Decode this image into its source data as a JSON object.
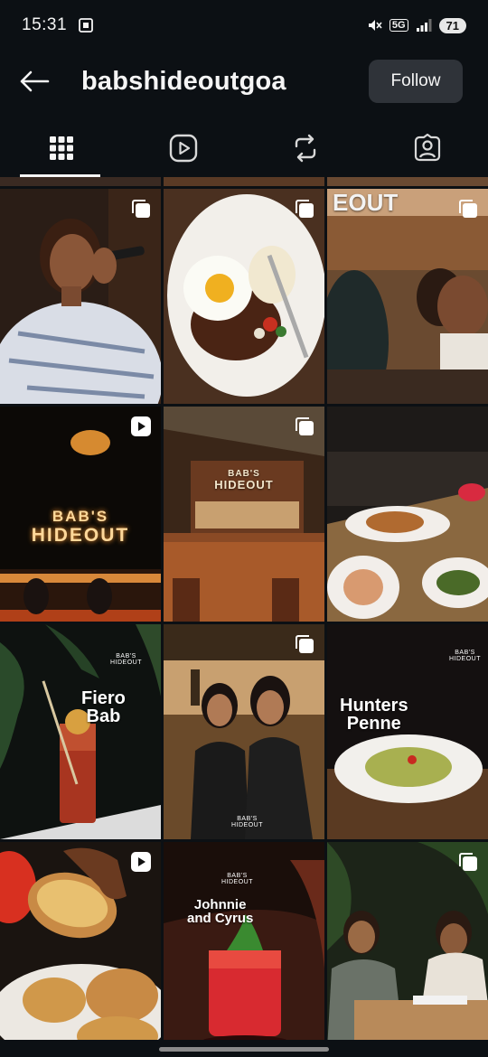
{
  "status": {
    "time": "15:31",
    "network": "5G",
    "battery": "71",
    "icons": [
      "screenshot-icon",
      "mute-icon",
      "signal-icon"
    ]
  },
  "header": {
    "back_icon": "arrow-left-icon",
    "username": "babshideoutgoa",
    "follow_label": "Follow"
  },
  "tabs": [
    {
      "name": "posts",
      "icon": "grid-icon",
      "active": true
    },
    {
      "name": "reels",
      "icon": "reels-play-icon",
      "active": false
    },
    {
      "name": "reposts",
      "icon": "repost-icon",
      "active": false
    },
    {
      "name": "tagged",
      "icon": "tagged-person-icon",
      "active": false
    }
  ],
  "posts": [
    {
      "id": 1,
      "subject": "woman-singing-with-microphone",
      "badge": "carousel-icon"
    },
    {
      "id": 2,
      "subject": "fried-egg-steak-plate",
      "badge": "carousel-icon"
    },
    {
      "id": 3,
      "subject": "friends-at-bar",
      "badge": "carousel-icon",
      "sign_text": "EOUT"
    },
    {
      "id": 4,
      "subject": "neon-bar-sign",
      "badge": "reel-icon",
      "sign_line1": "BAB'S",
      "sign_line2": "HIDEOUT"
    },
    {
      "id": 5,
      "subject": "bar-interior",
      "badge": "carousel-icon",
      "sign_line1": "BAB'S",
      "sign_line2": "HIDEOUT"
    },
    {
      "id": 6,
      "subject": "dishes-and-cocktail",
      "badge": "carousel-icon"
    },
    {
      "id": 7,
      "subject": "fiero-bab-cocktail",
      "badge": "none",
      "brand_line1": "BAB'S",
      "brand_line2": "HIDEOUT",
      "title_line1": "Fiero",
      "title_line2": "Bab"
    },
    {
      "id": 8,
      "subject": "two-women-posing",
      "badge": "carousel-icon",
      "brand_line1": "BAB'S",
      "brand_line2": "HIDEOUT"
    },
    {
      "id": 9,
      "subject": "hunters-penne-pasta",
      "badge": "none",
      "brand_line1": "BAB'S",
      "brand_line2": "HIDEOUT",
      "title_line1": "Hunters",
      "title_line2": "Penne"
    },
    {
      "id": 10,
      "subject": "bruschetta-plate",
      "badge": "reel-icon"
    },
    {
      "id": 11,
      "subject": "johnnie-and-cyrus-cocktail",
      "badge": "none",
      "brand_line1": "BAB'S",
      "brand_line2": "HIDEOUT",
      "title_line1": "Johnnie",
      "title_line2": "and Cyrus"
    },
    {
      "id": 12,
      "subject": "two-women-at-table",
      "badge": "carousel-icon"
    }
  ]
}
